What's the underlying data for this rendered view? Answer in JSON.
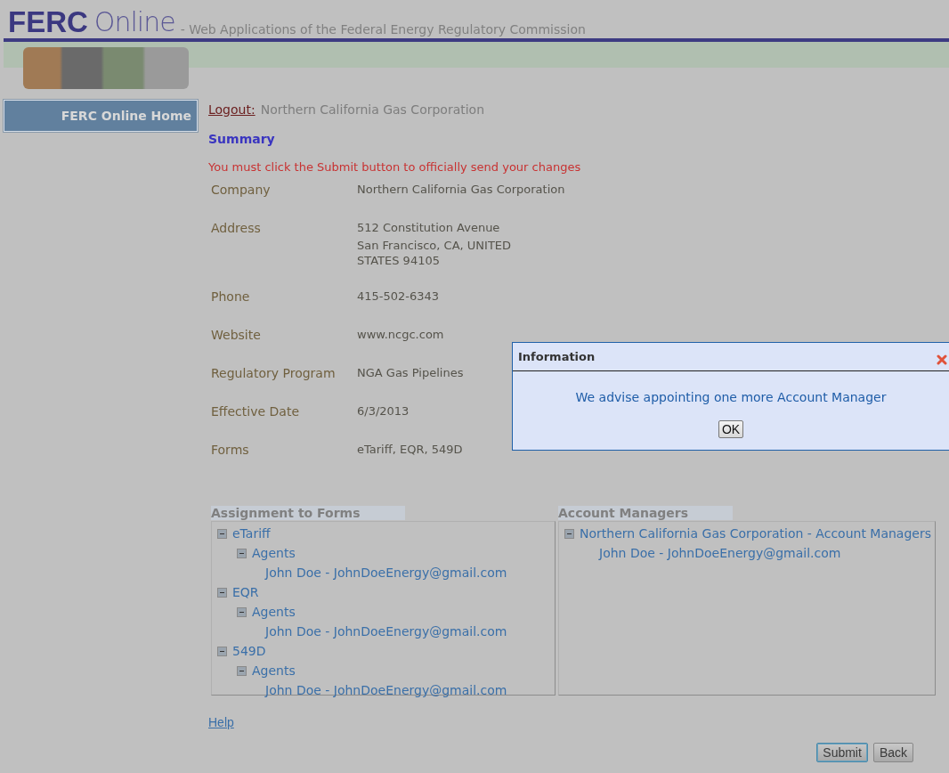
{
  "header": {
    "logo_bold": "FERC",
    "logo_light": "Online",
    "tagline": "- Web Applications of the Federal Energy Regulatory Commission"
  },
  "sidebar": {
    "items": [
      {
        "label": "FERC Online Home",
        "selected": true
      }
    ]
  },
  "account": {
    "logout": "Logout:",
    "name": "Northern California Gas Corporation"
  },
  "title": "Summary",
  "notice": "You must click the Submit button to officially send your changes",
  "details": [
    {
      "label": "Company",
      "lines": [
        "Northern California Gas Corporation"
      ]
    },
    {
      "label": "Address",
      "lines": [
        "512 Constitution Avenue",
        "San Francisco, CA, UNITED",
        "STATES 94105"
      ]
    },
    {
      "label": "Phone",
      "lines": [
        "415-502-6343"
      ]
    },
    {
      "label": "Website",
      "lines": [
        "www.ncgc.com"
      ]
    },
    {
      "label": "Regulatory Program",
      "lines": [
        "NGA Gas Pipelines"
      ]
    },
    {
      "label": "Effective Date",
      "lines": [
        "6/3/2013"
      ]
    },
    {
      "label": "Forms",
      "lines": [
        "eTariff, EQR, 549D"
      ]
    }
  ],
  "panels": [
    {
      "heading": "Assignment to Forms",
      "tree": [
        {
          "label": "eTariff",
          "expanded": true,
          "children": [
            {
              "label": "Agents",
              "expanded": true,
              "children": [
                {
                  "label": "John Doe - JohnDoeEnergy@gmail.com"
                }
              ]
            }
          ]
        },
        {
          "label": "EQR",
          "expanded": true,
          "children": [
            {
              "label": "Agents",
              "expanded": true,
              "children": [
                {
                  "label": "John Doe - JohnDoeEnergy@gmail.com"
                }
              ]
            }
          ]
        },
        {
          "label": "549D",
          "expanded": true,
          "children": [
            {
              "label": "Agents",
              "expanded": true,
              "children": [
                {
                  "label": "John Doe - JohnDoeEnergy@gmail.com"
                }
              ]
            }
          ]
        }
      ]
    },
    {
      "heading": "Account Managers",
      "tree": [
        {
          "label": "Northern California Gas Corporation - Account Managers",
          "expanded": true,
          "children": [
            {
              "label": "John Doe - JohnDoeEnergy@gmail.com"
            }
          ]
        }
      ]
    }
  ],
  "help": "Help",
  "buttons": [
    {
      "label": "Submit",
      "selected": true
    },
    {
      "label": "Back",
      "selected": false
    }
  ],
  "dialog": {
    "title": "Information",
    "message": "We advise appointing one more Account Manager",
    "button": "OK"
  }
}
